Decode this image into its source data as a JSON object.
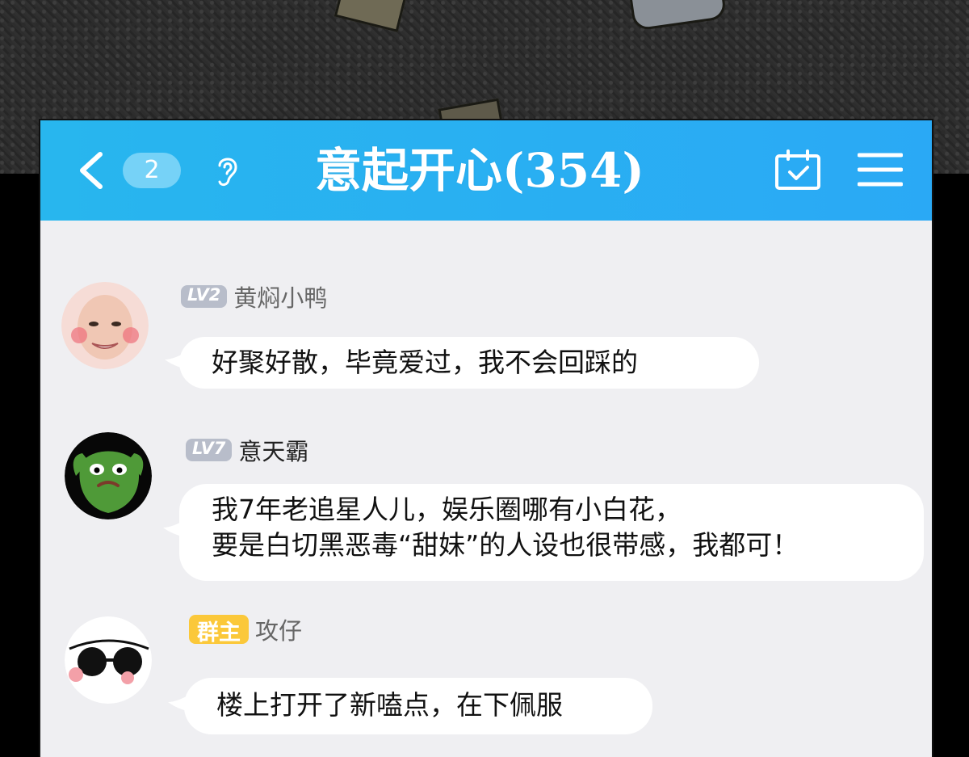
{
  "header": {
    "back_icon": "chevron-left-icon",
    "unread_count": "2",
    "voice_icon": "ear-icon",
    "title": "意起开心(354)",
    "calendar_icon": "calendar-check-icon",
    "menu_icon": "menu-icon"
  },
  "colors": {
    "header_blue": "#28b6ee",
    "chat_background": "#efeff2",
    "bubble": "#ffffff",
    "level_badge": "#b8bdca",
    "owner_badge": "#fbc83a"
  },
  "messages": [
    {
      "badge": "LV2",
      "name": "黄焖小鸭",
      "lines": [
        "好聚好散，毕竟爱过，我不会回踩的"
      ]
    },
    {
      "badge": "LV7",
      "name": "意天霸",
      "lines": [
        "我7年老追星人儿，娱乐圈哪有小白花，",
        "要是白切黑恶毒“甜妹”的人设也很带感，我都可！"
      ]
    },
    {
      "badge": "群主",
      "name": "攻仔",
      "lines": [
        "楼上打开了新嗑点，在下佩服"
      ]
    }
  ]
}
